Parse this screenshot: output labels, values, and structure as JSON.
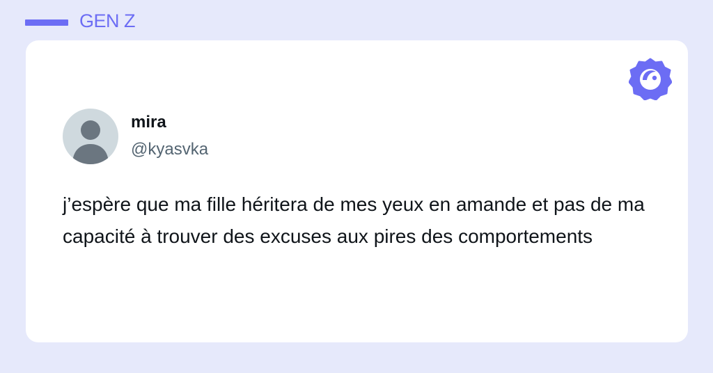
{
  "header": {
    "tag": "GEN Z",
    "accent_color": "#6c6df4"
  },
  "tweet": {
    "author_name": "mira",
    "author_handle": "@kyasvka",
    "avatar_icon": "default-avatar-icon",
    "text": "j’espère que ma fille héritera de mes yeux en amande et pas de ma capacité à trouver des excuses aux pires des comportements"
  },
  "brand": {
    "icon": "brand-logo-icon",
    "color": "#6c6df4"
  },
  "colors": {
    "background": "#e6e9fb",
    "card": "#ffffff",
    "text": "#0f1419",
    "muted": "#536471"
  }
}
